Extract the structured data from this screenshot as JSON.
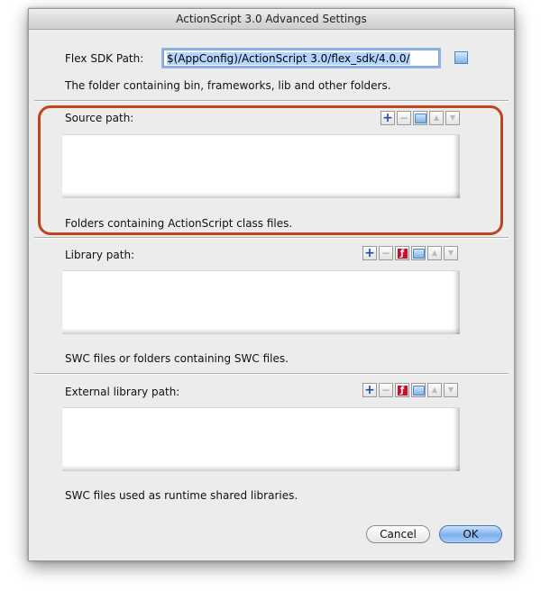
{
  "window": {
    "title": "ActionScript 3.0 Advanced Settings"
  },
  "sdk": {
    "label": "Flex SDK Path:",
    "value": "$(AppConfig)/ActionScript 3.0/flex_sdk/4.0.0/",
    "hint": "The folder containing bin, frameworks, lib and other folders."
  },
  "source": {
    "label": "Source path:",
    "hint": "Folders containing ActionScript class files."
  },
  "library": {
    "label": "Library path:",
    "hint": "SWC files or folders containing SWC files."
  },
  "external": {
    "label": "External library path:",
    "hint": "SWC files used as runtime shared libraries."
  },
  "buttons": {
    "cancel": "Cancel",
    "ok": "OK"
  },
  "icons": {
    "add": "plus-icon",
    "remove": "minus-icon",
    "browse": "folder-icon",
    "flash": "flash-icon",
    "up": "arrow-up-icon",
    "down": "arrow-down-icon"
  },
  "colors": {
    "highlight": "#c0441e",
    "accent": "#7db0ee"
  }
}
